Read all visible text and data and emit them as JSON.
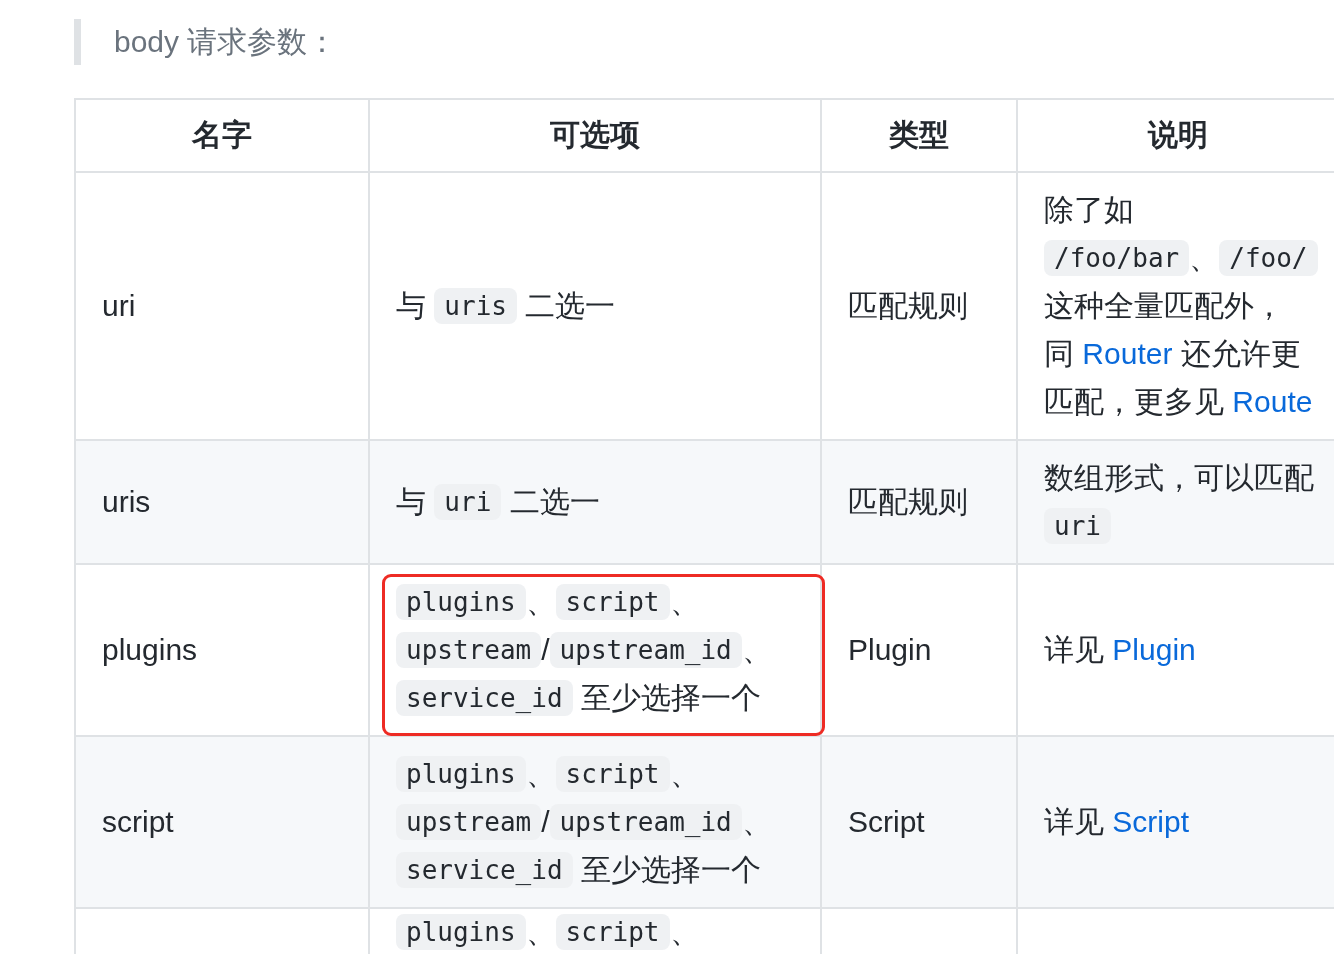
{
  "note": {
    "text": "body 请求参数："
  },
  "table": {
    "columns": [
      "名字",
      "可选项",
      "类型",
      "说明"
    ],
    "rows": [
      {
        "name": "uri",
        "options": [
          [
            {
              "kind": "text",
              "text": "与 "
            },
            {
              "kind": "code",
              "text": "uris"
            },
            {
              "kind": "text",
              "text": " 二选一"
            }
          ]
        ],
        "type": "匹配规则",
        "description": [
          [
            {
              "kind": "text",
              "text": "除了如"
            }
          ],
          [
            {
              "kind": "code",
              "text": "/foo/bar"
            },
            {
              "kind": "text",
              "text": "、"
            },
            {
              "kind": "code",
              "text": "/foo/"
            }
          ],
          [
            {
              "kind": "text",
              "text": "这种全量匹配外，"
            }
          ],
          [
            {
              "kind": "text",
              "text": "同 "
            },
            {
              "kind": "link",
              "text": "Router"
            },
            {
              "kind": "text",
              "text": " 还允许更"
            }
          ],
          [
            {
              "kind": "text",
              "text": "匹配，更多见 "
            },
            {
              "kind": "link",
              "text": "Route"
            }
          ]
        ],
        "highlighted": false
      },
      {
        "name": "uris",
        "options": [
          [
            {
              "kind": "text",
              "text": "与 "
            },
            {
              "kind": "code",
              "text": "uri"
            },
            {
              "kind": "text",
              "text": " 二选一"
            }
          ]
        ],
        "type": "匹配规则",
        "description": [
          [
            {
              "kind": "text",
              "text": "数组形式，可以匹配"
            }
          ],
          [
            {
              "kind": "code",
              "text": "uri"
            }
          ]
        ],
        "highlighted": false
      },
      {
        "name": "plugins",
        "options": [
          [
            {
              "kind": "code",
              "text": "plugins"
            },
            {
              "kind": "text",
              "text": "、"
            },
            {
              "kind": "code",
              "text": "script"
            },
            {
              "kind": "text",
              "text": "、"
            }
          ],
          [
            {
              "kind": "code",
              "text": "upstream"
            },
            {
              "kind": "text",
              "text": "/"
            },
            {
              "kind": "code",
              "text": "upstream_id"
            },
            {
              "kind": "text",
              "text": "、"
            }
          ],
          [
            {
              "kind": "code",
              "text": "service_id"
            },
            {
              "kind": "text",
              "text": " 至少选择一个"
            }
          ]
        ],
        "type": "Plugin",
        "description": [
          [
            {
              "kind": "text",
              "text": "详见 "
            },
            {
              "kind": "link",
              "text": "Plugin"
            }
          ]
        ],
        "highlighted": true
      },
      {
        "name": "script",
        "options": [
          [
            {
              "kind": "code",
              "text": "plugins"
            },
            {
              "kind": "text",
              "text": "、"
            },
            {
              "kind": "code",
              "text": "script"
            },
            {
              "kind": "text",
              "text": "、"
            }
          ],
          [
            {
              "kind": "code",
              "text": "upstream"
            },
            {
              "kind": "text",
              "text": "/"
            },
            {
              "kind": "code",
              "text": "upstream_id"
            },
            {
              "kind": "text",
              "text": "、"
            }
          ],
          [
            {
              "kind": "code",
              "text": "service_id"
            },
            {
              "kind": "text",
              "text": " 至少选择一个"
            }
          ]
        ],
        "type": "Script",
        "description": [
          [
            {
              "kind": "text",
              "text": "详见 "
            },
            {
              "kind": "link",
              "text": "Script"
            }
          ]
        ],
        "highlighted": false
      },
      {
        "options": [
          [
            {
              "kind": "code",
              "text": "plugins"
            },
            {
              "kind": "text",
              "text": "、"
            },
            {
              "kind": "code",
              "text": "script"
            },
            {
              "kind": "text",
              "text": "、"
            }
          ]
        ],
        "highlighted": false
      }
    ]
  }
}
